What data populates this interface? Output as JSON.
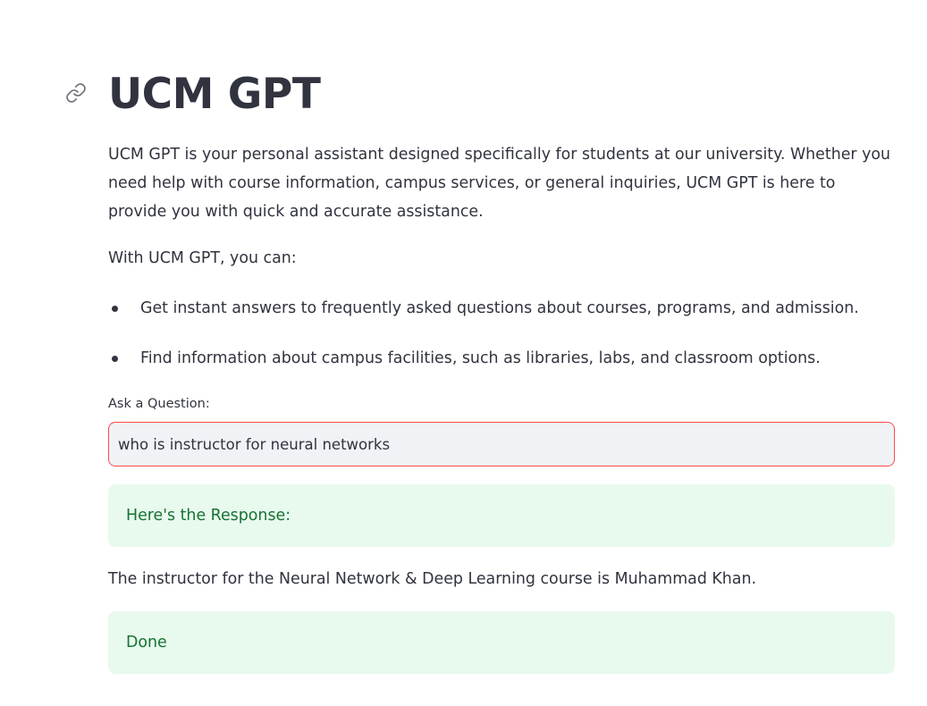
{
  "header": {
    "title": "UCM GPT",
    "anchor_icon": "link-icon"
  },
  "intro": {
    "paragraph": "UCM GPT is your personal assistant designed specifically for students at our university. Whether you need help with course information, campus services, or general inquiries, UCM GPT is here to provide you with quick and accurate assistance.",
    "with_line": "With UCM GPT, you can:"
  },
  "features": [
    "Get instant answers to frequently asked questions about courses, programs, and admission.",
    "Find information about campus facilities, such as libraries, labs, and classroom options."
  ],
  "question": {
    "label": "Ask a Question:",
    "value": "who is instructor for neural networks"
  },
  "response": {
    "header": "Here's the Response:",
    "answer": "The instructor for the Neural Network & Deep Learning course is Muhammad Khan.",
    "status": "Done"
  },
  "colors": {
    "text": "#31333f",
    "input_border_focus": "#ff4b4b",
    "input_background": "#f0f2f6",
    "success_background": "#e8f9ee",
    "success_text": "#177233"
  }
}
